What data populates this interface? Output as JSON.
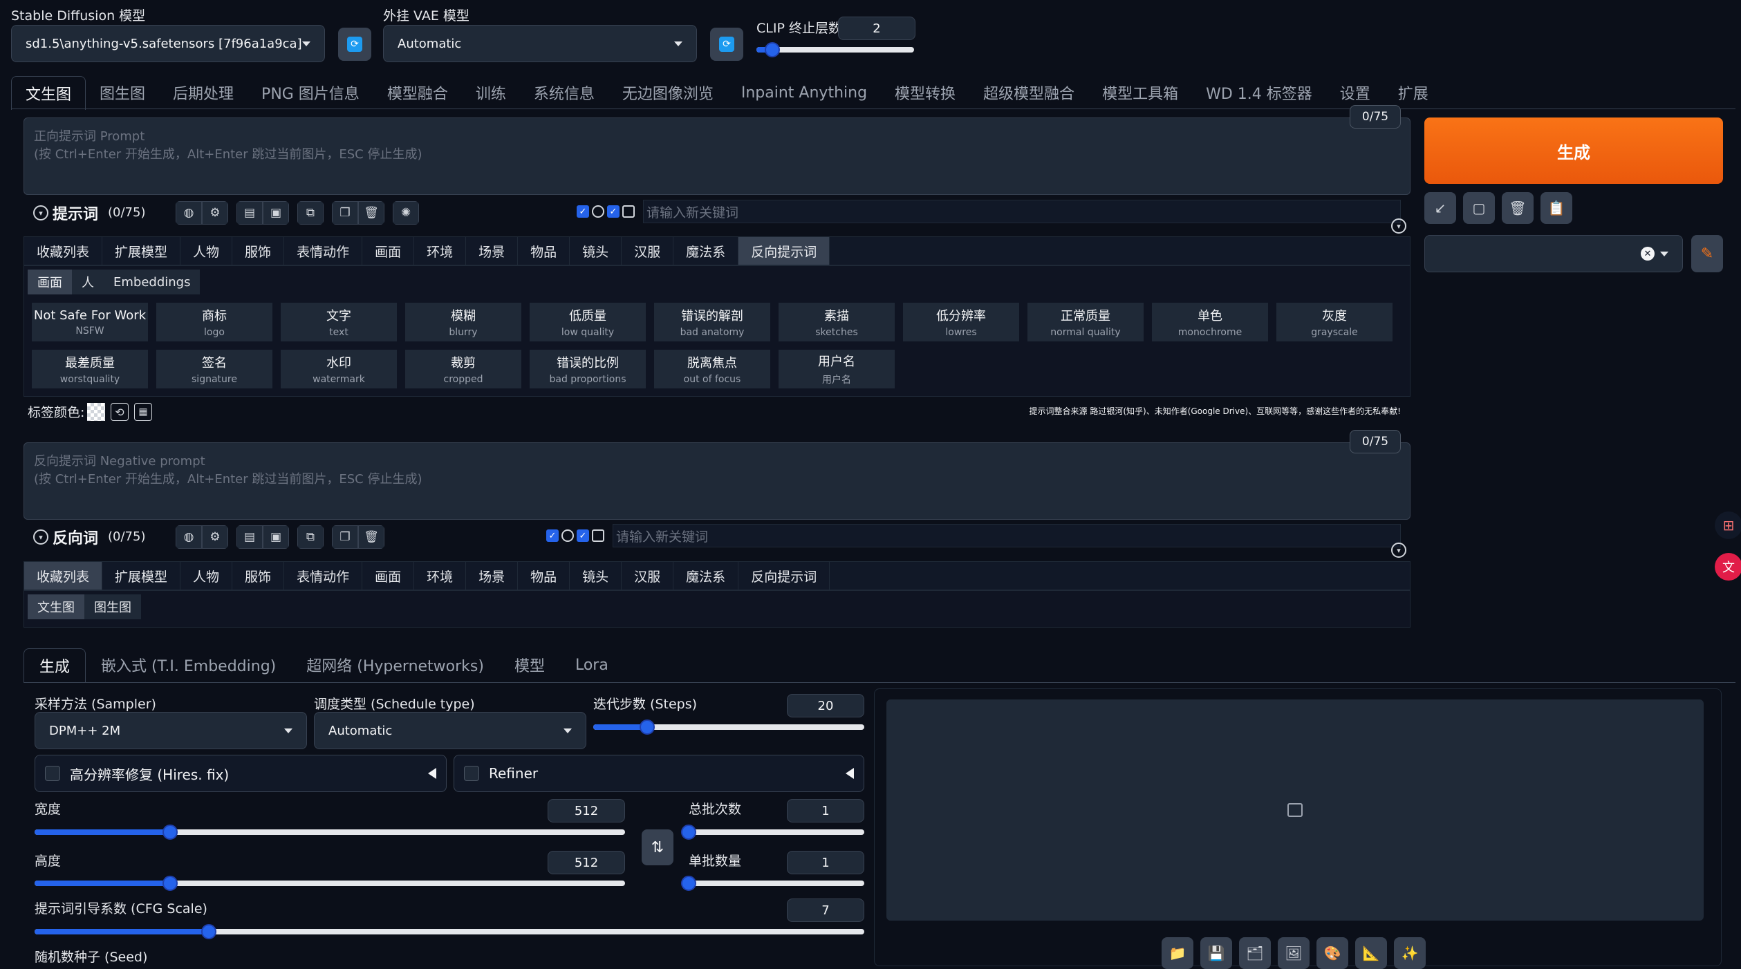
{
  "top": {
    "sd_label": "Stable Diffusion 模型",
    "sd_value": "sd1.5\\anything-v5.safetensors [7f96a1a9ca]",
    "vae_label": "外挂 VAE 模型",
    "vae_value": "Automatic",
    "clip_label": "CLIP 终止层数",
    "clip_value": "2",
    "clip_slider": 0.1
  },
  "main_tabs": [
    "文生图",
    "图生图",
    "后期处理",
    "PNG 图片信息",
    "模型融合",
    "训练",
    "系统信息",
    "无边图像浏览",
    "Inpaint Anything",
    "模型转换",
    "超级模型融合",
    "模型工具箱",
    "WD 1.4 标签器",
    "设置",
    "扩展"
  ],
  "prompt": {
    "counter": "0/75",
    "placeholder_1": "正向提示词 Prompt",
    "placeholder_2": "(按 Ctrl+Enter 开始生成，Alt+Enter 跳过当前图片，ESC 停止生成)",
    "title": "提示词",
    "count": "(0/75)",
    "kw_placeholder": "请输入新关键词"
  },
  "categories": [
    "收藏列表",
    "扩展模型",
    "人物",
    "服饰",
    "表情动作",
    "画面",
    "环境",
    "场景",
    "物品",
    "镜头",
    "汉服",
    "魔法系",
    "反向提示词"
  ],
  "sub_tabs": [
    "画面",
    "人",
    "Embeddings"
  ],
  "chips": [
    {
      "cn": "Not Safe For Work",
      "en": "NSFW"
    },
    {
      "cn": "商标",
      "en": "logo"
    },
    {
      "cn": "文字",
      "en": "text"
    },
    {
      "cn": "模糊",
      "en": "blurry"
    },
    {
      "cn": "低质量",
      "en": "low quality"
    },
    {
      "cn": "错误的解剖",
      "en": "bad anatomy"
    },
    {
      "cn": "素描",
      "en": "sketches"
    },
    {
      "cn": "低分辨率",
      "en": "lowres"
    },
    {
      "cn": "正常质量",
      "en": "normal quality"
    },
    {
      "cn": "单色",
      "en": "monochrome"
    },
    {
      "cn": "灰度",
      "en": "grayscale"
    },
    {
      "cn": "最差质量",
      "en": "worstquality"
    },
    {
      "cn": "签名",
      "en": "signature"
    },
    {
      "cn": "水印",
      "en": "watermark"
    },
    {
      "cn": "裁剪",
      "en": "cropped"
    },
    {
      "cn": "错误的比例",
      "en": "bad proportions"
    },
    {
      "cn": "脱离焦点",
      "en": "out of focus"
    },
    {
      "cn": "用户名",
      "en": "用户名"
    }
  ],
  "tag_color_label": "标签颜色:",
  "credit_note": "提示词整合来源 路过银河(知乎)、未知作者(Google Drive)、互联网等等，感谢这些作者的无私奉献!",
  "negative": {
    "counter": "0/75",
    "placeholder_1": "反向提示词 Negative prompt",
    "placeholder_2": "(按 Ctrl+Enter 开始生成，Alt+Enter 跳过当前图片，ESC 停止生成)",
    "title": "反向词",
    "count": "(0/75)",
    "kw_placeholder": "请输入新关键词"
  },
  "neg_sub_tabs": [
    "文生图",
    "图生图"
  ],
  "generate_label": "生成",
  "bottom_tabs": [
    "生成",
    "嵌入式 (T.I. Embedding)",
    "超网络 (Hypernetworks)",
    "模型",
    "Lora"
  ],
  "params": {
    "sampler_label": "采样方法 (Sampler)",
    "sampler_value": "DPM++ 2M",
    "schedule_label": "调度类型 (Schedule type)",
    "schedule_value": "Automatic",
    "steps_label": "迭代步数 (Steps)",
    "steps_value": "20",
    "steps_frac": 0.2,
    "hires_label": "高分辨率修复 (Hires. fix)",
    "refiner_label": "Refiner",
    "width_label": "宽度",
    "width_value": "512",
    "width_frac": 0.23,
    "height_label": "高度",
    "height_value": "512",
    "height_frac": 0.23,
    "batch_count_label": "总批次数",
    "batch_count_value": "1",
    "batch_count_frac": 0.0,
    "batch_size_label": "单批数量",
    "batch_size_value": "1",
    "batch_size_frac": 0.0,
    "cfg_label": "提示词引导系数 (CFG Scale)",
    "cfg_value": "7",
    "cfg_frac": 0.21,
    "seed_label": "随机数种子 (Seed)"
  },
  "colors": {
    "accent": "#ea580c",
    "slider": "#2563eb",
    "bg": "#0b0f19"
  }
}
